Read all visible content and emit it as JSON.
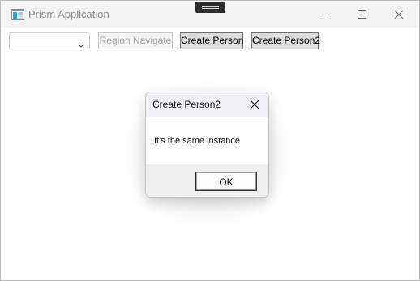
{
  "window": {
    "title": "Prism Application"
  },
  "toolbar": {
    "combo_value": "",
    "region_navigate_label": "Region Navigate",
    "create_person_label": "Create Person",
    "create_person2_label": "Create Person2"
  },
  "dialog": {
    "title": "Create Person2",
    "message": "It's the same instance",
    "ok_label": "OK"
  },
  "icons": {
    "app": "app-window-icon",
    "minimize": "minimize-icon",
    "maximize": "maximize-icon",
    "close": "close-icon",
    "combo_arrow": "chevron-down-icon",
    "dialog_close": "close-icon"
  }
}
